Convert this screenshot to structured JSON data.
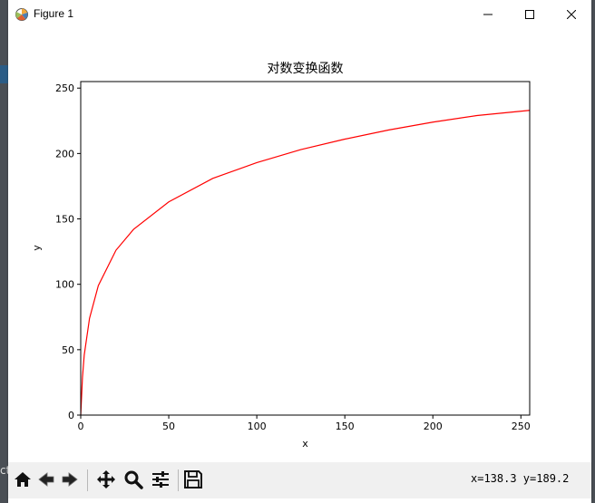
{
  "window": {
    "title": "Figure 1",
    "controls": [
      "minimize",
      "maximize",
      "close"
    ]
  },
  "background": {
    "partial_text": "ct"
  },
  "toolbar": {
    "buttons": [
      {
        "name": "home",
        "icon": "home-icon"
      },
      {
        "name": "back",
        "icon": "arrow-left-icon"
      },
      {
        "name": "forward",
        "icon": "arrow-right-icon"
      },
      {
        "name": "pan",
        "icon": "move-icon"
      },
      {
        "name": "zoom",
        "icon": "magnifier-icon"
      },
      {
        "name": "configure",
        "icon": "sliders-icon"
      },
      {
        "name": "save",
        "icon": "floppy-disk-icon"
      }
    ],
    "coords": "x=138.3  y=189.2"
  },
  "chart_data": {
    "type": "line",
    "title": "对数变换函数",
    "xlabel": "x",
    "ylabel": "y",
    "xlim": [
      0,
      255
    ],
    "ylim": [
      0,
      255
    ],
    "xticks": [
      0,
      50,
      100,
      150,
      200,
      250
    ],
    "yticks": [
      0,
      50,
      100,
      150,
      200,
      250
    ],
    "grid": false,
    "series": [
      {
        "color": "#ff0000",
        "x": [
          0,
          1,
          2,
          5,
          10,
          20,
          30,
          50,
          75,
          100,
          125,
          150,
          175,
          200,
          225,
          255
        ],
        "y": [
          0,
          29,
          46,
          74,
          99,
          126,
          142,
          163,
          181,
          193,
          203,
          211,
          218,
          224,
          229,
          233
        ]
      }
    ]
  }
}
